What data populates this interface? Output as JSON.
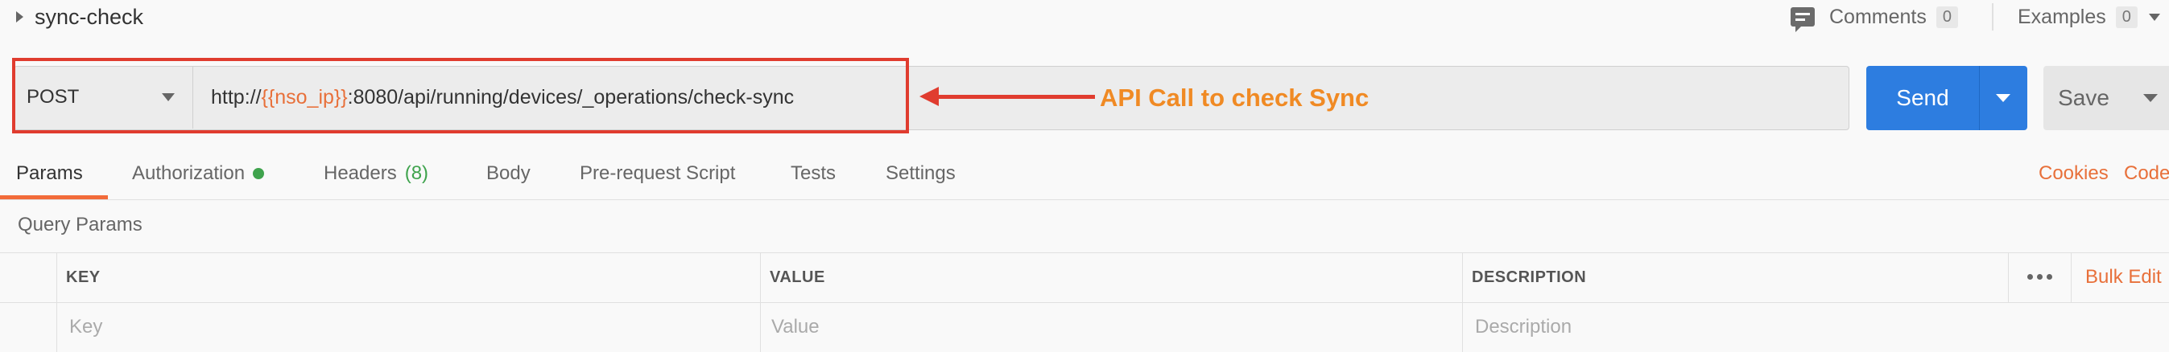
{
  "request": {
    "name": "sync-check"
  },
  "header": {
    "comments_label": "Comments",
    "comments_count": "0",
    "examples_label": "Examples",
    "examples_count": "0"
  },
  "url_bar": {
    "method": "POST",
    "url_prefix": "http://",
    "url_variable": "{{nso_ip}}",
    "url_suffix": ":8080/api/running/devices/_operations/check-sync",
    "annotation": "API Call to check Sync",
    "send_label": "Send",
    "save_label": "Save"
  },
  "tabs": [
    {
      "label": "Params",
      "active": true
    },
    {
      "label": "Authorization",
      "indicator": "green-dot"
    },
    {
      "label": "Headers",
      "count": "(8)"
    },
    {
      "label": "Body"
    },
    {
      "label": "Pre-request Script"
    },
    {
      "label": "Tests"
    },
    {
      "label": "Settings"
    }
  ],
  "tab_links": {
    "cookies": "Cookies",
    "code": "Code"
  },
  "query_params": {
    "title": "Query Params",
    "columns": [
      "KEY",
      "VALUE",
      "DESCRIPTION"
    ],
    "placeholders": [
      "Key",
      "Value",
      "Description"
    ],
    "bulk_edit": "Bulk Edit"
  },
  "colors": {
    "accent_orange": "#e8703a",
    "send_blue": "#2d7de0",
    "annotation_red": "#e03c2f",
    "annotation_text": "#f08a24",
    "auth_green": "#3fa34d"
  }
}
